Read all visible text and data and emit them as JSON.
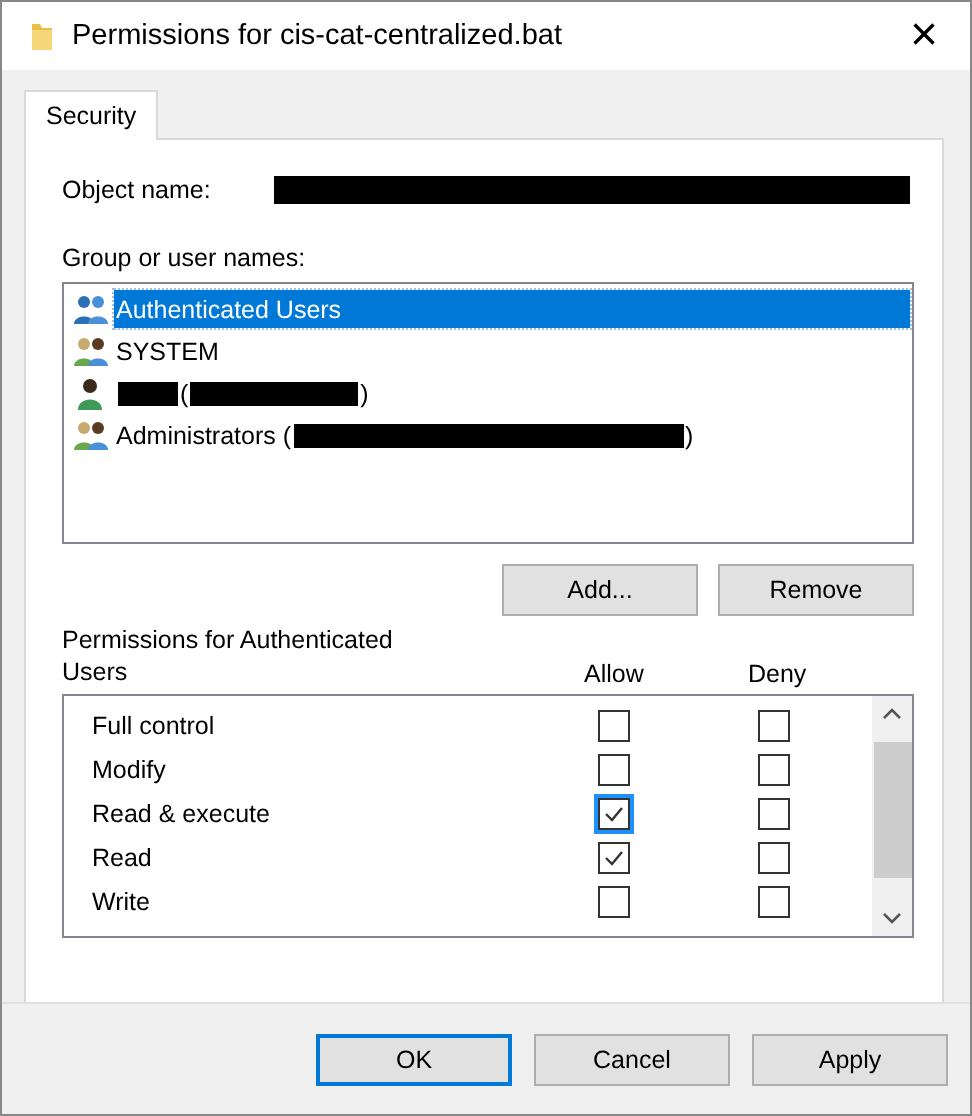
{
  "window": {
    "title": "Permissions for cis-cat-centralized.bat",
    "close": "×"
  },
  "tabs": [
    {
      "label": "Security",
      "selected": true
    }
  ],
  "object_name": {
    "label": "Object name:",
    "redacted": true
  },
  "group_label": "Group or user names:",
  "users": [
    {
      "kind": "builtin-group",
      "selected": true,
      "parts": [
        {
          "kind": "text",
          "text": "Authenticated Users"
        }
      ]
    },
    {
      "kind": "group",
      "selected": false,
      "parts": [
        {
          "kind": "text",
          "text": "SYSTEM"
        }
      ]
    },
    {
      "kind": "user",
      "selected": false,
      "parts": [
        {
          "kind": "redacted"
        },
        {
          "kind": "text",
          "text": "("
        },
        {
          "kind": "redacted"
        },
        {
          "kind": "text",
          "text": ")"
        }
      ]
    },
    {
      "kind": "group",
      "selected": false,
      "parts": [
        {
          "kind": "text",
          "text": "Administrators ("
        },
        {
          "kind": "redacted"
        },
        {
          "kind": "text",
          "text": ")"
        }
      ]
    }
  ],
  "user_buttons": [
    "Add...",
    "Remove"
  ],
  "permissions_label": "Permissions for Authenticated Users",
  "columns": [
    "Allow",
    "Deny"
  ],
  "permissions": [
    {
      "name": "Full control",
      "allow": false,
      "deny": false,
      "focused": false
    },
    {
      "name": "Modify",
      "allow": false,
      "deny": false,
      "focused": false
    },
    {
      "name": "Read & execute",
      "allow": true,
      "deny": false,
      "focused": true
    },
    {
      "name": "Read",
      "allow": true,
      "deny": false,
      "focused": false
    },
    {
      "name": "Write",
      "allow": false,
      "deny": false,
      "focused": false
    }
  ],
  "buttons": [
    {
      "label": "OK",
      "default": true
    },
    {
      "label": "Cancel",
      "default": false
    },
    {
      "label": "Apply",
      "default": false
    }
  ]
}
